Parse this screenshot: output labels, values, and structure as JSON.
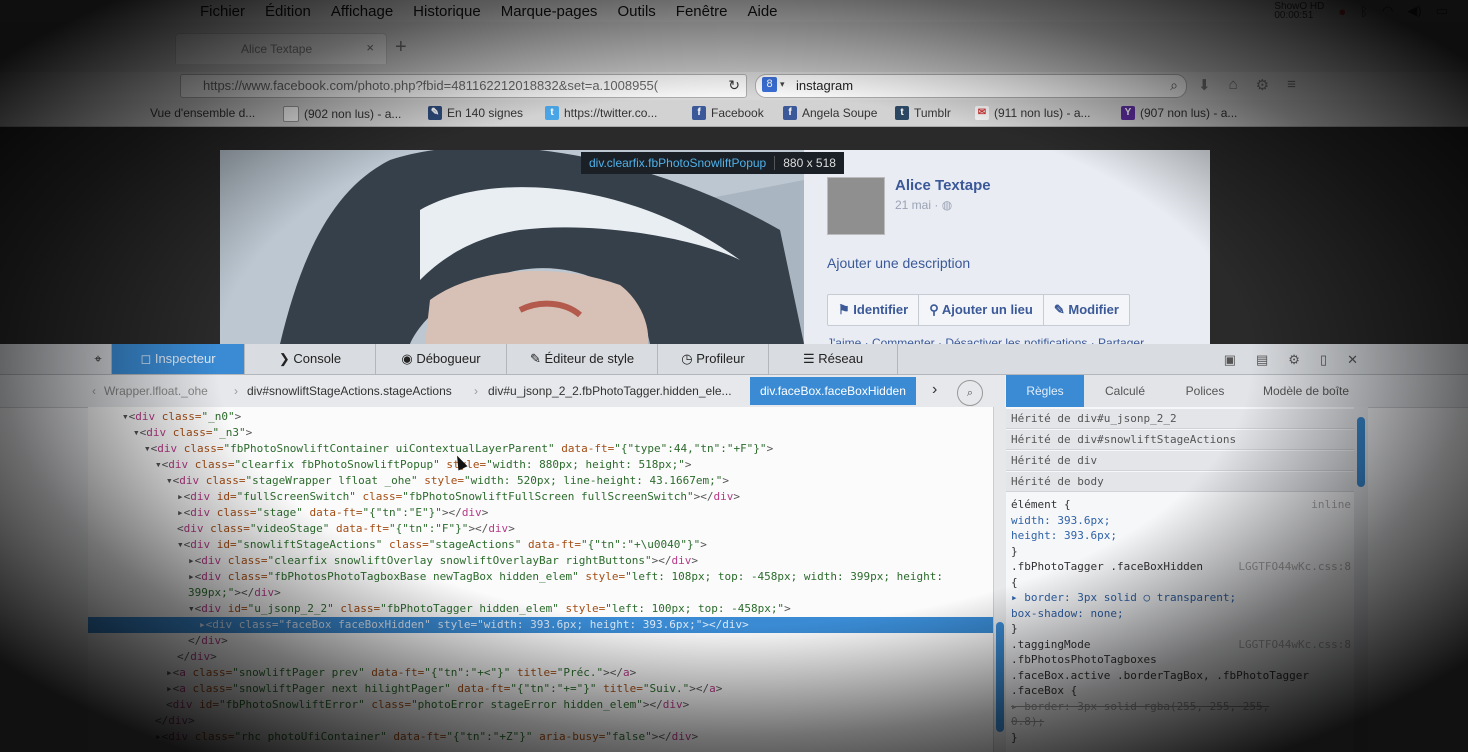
{
  "menubar": {
    "items": [
      "Fichier",
      "Édition",
      "Affichage",
      "Historique",
      "Marque-pages",
      "Outils",
      "Fenêtre",
      "Aide"
    ],
    "clock_top": "ShowO HD",
    "clock_bottom": "00:00:51"
  },
  "browser": {
    "tab_title": "Alice Textape",
    "tab_close": "×",
    "newtab": "+",
    "url": "https://www.facebook.com/photo.php?fbid=481162212018832&set=a.1008955(",
    "search_engine": "8",
    "search_query": "instagram",
    "bookmarks": [
      {
        "label": "Vue d'ensemble d...",
        "icon": "page-icon"
      },
      {
        "label": "(902 non lus) - a...",
        "icon": "page-icon"
      },
      {
        "label": "En 140 signes",
        "icon": "bookmark-icon"
      },
      {
        "label": "https://twitter.co...",
        "icon": "twitter-icon"
      },
      {
        "label": "Facebook",
        "icon": "facebook-icon"
      },
      {
        "label": "Angela Soupe",
        "icon": "facebook-icon"
      },
      {
        "label": "Tumblr",
        "icon": "tumblr-icon"
      },
      {
        "label": "(911 non lus) - a...",
        "icon": "mail-icon"
      },
      {
        "label": "(907 non lus) - a...",
        "icon": "yahoo-icon"
      }
    ]
  },
  "facebook": {
    "user": "Alice Textape",
    "date": "21 mai · ",
    "add_description": "Ajouter une description",
    "actions": [
      "Identifier",
      "Ajouter un lieu",
      "Modifier"
    ],
    "likes_line": "J'aime · Commenter · Désactiver les notifications · Partager"
  },
  "inspector_tooltip": {
    "selector": "div.clearfix.fbPhotoSnowliftPopup",
    "size": "880 x 518"
  },
  "devtools": {
    "tabs": [
      "Inspecteur",
      "Console",
      "Débogueur",
      "Éditeur de style",
      "Profileur",
      "Réseau"
    ],
    "breadcrumbs": [
      "Wrapper.lfloat._ohe",
      "div#snowliftStageActions.stageActions",
      "div#u_jsonp_2_2.fbPhotoTagger.hidden_ele...",
      "div.faceBox.faceBoxHidden"
    ],
    "side_tabs": [
      "Règles",
      "Calculé",
      "Polices",
      "Modèle de boîte"
    ],
    "inherited": [
      "Hérité de div#u_jsonp_2_2",
      "Hérité de div#snowliftStageActions",
      "Hérité de div",
      "Hérité de body"
    ],
    "rules": [
      {
        "text": "élément {",
        "src": "inline"
      },
      {
        "text": "    width: 393.6px;",
        "src": ""
      },
      {
        "text": "    height: 393.6px;",
        "src": ""
      },
      {
        "text": "}",
        "src": ""
      },
      {
        "text": ".fbPhotoTagger .faceBoxHidden",
        "src": "LGGTFO44wKc.css:8"
      },
      {
        "text": "{",
        "src": ""
      },
      {
        "text": "  ▸ border: 3px solid ○ transparent;",
        "src": ""
      },
      {
        "text": "    box-shadow: none;",
        "src": ""
      },
      {
        "text": "}",
        "src": ""
      },
      {
        "text": ".taggingMode",
        "src": "LGGTFO44wKc.css:8"
      },
      {
        "text": ".fbPhotosPhotoTagboxes",
        "src": ""
      },
      {
        "text": ".faceBox.active .borderTagBox, .fbPhotoTagger",
        "src": ""
      },
      {
        "text": ".faceBox {",
        "src": ""
      },
      {
        "text": "  ▸ border: 3px solid  rgba(255, 255, 255,",
        "src": ""
      },
      {
        "text": "0.8);",
        "src": ""
      },
      {
        "text": "}",
        "src": ""
      }
    ],
    "markup": [
      {
        "i": 4,
        "parts": [
          [
            "p",
            "▾<"
          ],
          [
            "t",
            "div"
          ],
          [
            "a",
            " class="
          ],
          [
            "v",
            "\"_n0\""
          ],
          [
            "p",
            ">"
          ]
        ]
      },
      {
        "i": 5,
        "parts": [
          [
            "p",
            "▾<"
          ],
          [
            "t",
            "div"
          ],
          [
            "a",
            " class="
          ],
          [
            "v",
            "\"_n3\""
          ],
          [
            "p",
            ">"
          ]
        ]
      },
      {
        "i": 6,
        "parts": [
          [
            "p",
            "▾<"
          ],
          [
            "t",
            "div"
          ],
          [
            "a",
            " class="
          ],
          [
            "v",
            "\"fbPhotoSnowliftContainer uiContextualLayerParent\""
          ],
          [
            "a",
            " data-ft="
          ],
          [
            "v",
            "\"{\"type\":44,\"tn\":\"+F\"}\""
          ],
          [
            "p",
            ">"
          ]
        ]
      },
      {
        "i": 7,
        "parts": [
          [
            "p",
            "▾<"
          ],
          [
            "t",
            "div"
          ],
          [
            "a",
            " class="
          ],
          [
            "v",
            "\"clearfix fbPhotoSnowliftPopup\""
          ],
          [
            "a",
            " style="
          ],
          [
            "v",
            "\"width: 880px; height: 518px;\""
          ],
          [
            "p",
            ">"
          ]
        ]
      },
      {
        "i": 8,
        "parts": [
          [
            "p",
            "▾<"
          ],
          [
            "t",
            "div"
          ],
          [
            "a",
            " class="
          ],
          [
            "v",
            "\"stageWrapper lfloat _ohe\""
          ],
          [
            "a",
            " style="
          ],
          [
            "v",
            "\"width: 520px; line-height: 43.1667em;\""
          ],
          [
            "p",
            ">"
          ]
        ]
      },
      {
        "i": 9,
        "parts": [
          [
            "p",
            "▸<"
          ],
          [
            "t",
            "div"
          ],
          [
            "a",
            " id="
          ],
          [
            "v",
            "\"fullScreenSwitch\""
          ],
          [
            "a",
            " class="
          ],
          [
            "v",
            "\"fbPhotoSnowliftFullScreen fullScreenSwitch\""
          ],
          [
            "p",
            "></"
          ],
          [
            "t",
            "div"
          ],
          [
            "p",
            ">"
          ]
        ]
      },
      {
        "i": 9,
        "parts": [
          [
            "p",
            "▸<"
          ],
          [
            "t",
            "div"
          ],
          [
            "a",
            " class="
          ],
          [
            "v",
            "\"stage\""
          ],
          [
            "a",
            " data-ft="
          ],
          [
            "v",
            "\"{\"tn\":\"E\"}\""
          ],
          [
            "p",
            "></"
          ],
          [
            "t",
            "div"
          ],
          [
            "p",
            ">"
          ]
        ]
      },
      {
        "i": 9,
        "parts": [
          [
            "p",
            " <"
          ],
          [
            "t",
            "div"
          ],
          [
            "a",
            " class="
          ],
          [
            "v",
            "\"videoStage\""
          ],
          [
            "a",
            " data-ft="
          ],
          [
            "v",
            "\"{\"tn\":\"F\"}\""
          ],
          [
            "p",
            "></"
          ],
          [
            "t",
            "div"
          ],
          [
            "p",
            ">"
          ]
        ]
      },
      {
        "i": 9,
        "parts": [
          [
            "p",
            "▾<"
          ],
          [
            "t",
            "div"
          ],
          [
            "a",
            " id="
          ],
          [
            "v",
            "\"snowliftStageActions\""
          ],
          [
            "a",
            " class="
          ],
          [
            "v",
            "\"stageActions\""
          ],
          [
            "a",
            " data-ft="
          ],
          [
            "v",
            "\"{\"tn\":\"+\\u0040\"}\""
          ],
          [
            "p",
            ">"
          ]
        ]
      },
      {
        "i": 10,
        "parts": [
          [
            "p",
            "▸<"
          ],
          [
            "t",
            "div"
          ],
          [
            "a",
            " class="
          ],
          [
            "v",
            "\"clearfix snowliftOverlay snowliftOverlayBar rightButtons\""
          ],
          [
            "p",
            "></"
          ],
          [
            "t",
            "div"
          ],
          [
            "p",
            ">"
          ]
        ]
      },
      {
        "i": 10,
        "parts": [
          [
            "p",
            "▸<"
          ],
          [
            "t",
            "div"
          ],
          [
            "a",
            " class="
          ],
          [
            "v",
            "\"fbPhotosPhotoTagboxBase newTagBox hidden_elem\""
          ],
          [
            "a",
            " style="
          ],
          [
            "v",
            "\"left: 108px; top: -458px; width: 399px; height:"
          ]
        ]
      },
      {
        "i": 10,
        "parts": [
          [
            "v",
            "399px;\""
          ],
          [
            "p",
            "></"
          ],
          [
            "t",
            "div"
          ],
          [
            "p",
            ">"
          ]
        ]
      },
      {
        "i": 10,
        "parts": [
          [
            "p",
            "▾<"
          ],
          [
            "t",
            "div"
          ],
          [
            "a",
            " id="
          ],
          [
            "v",
            "\"u_jsonp_2_2\""
          ],
          [
            "a",
            " class="
          ],
          [
            "v",
            "\"fbPhotoTagger hidden_elem\""
          ],
          [
            "a",
            " style="
          ],
          [
            "v",
            "\"left: 100px; top: -458px;\""
          ],
          [
            "p",
            ">"
          ]
        ]
      },
      {
        "i": 11,
        "sel": true,
        "parts": [
          [
            "p",
            "▸<"
          ],
          [
            "t",
            "div"
          ],
          [
            "a",
            " class="
          ],
          [
            "v",
            "\"faceBox faceBoxHidden\""
          ],
          [
            "a",
            " style="
          ],
          [
            "v",
            "\"width: 393.6px; height: 393.6px;\""
          ],
          [
            "p",
            "></"
          ],
          [
            "t",
            "div"
          ],
          [
            "p",
            ">"
          ]
        ]
      },
      {
        "i": 10,
        "parts": [
          [
            "p",
            "</"
          ],
          [
            "t",
            "div"
          ],
          [
            "p",
            ">"
          ]
        ]
      },
      {
        "i": 9,
        "parts": [
          [
            "p",
            "</"
          ],
          [
            "t",
            "div"
          ],
          [
            "p",
            ">"
          ]
        ]
      },
      {
        "i": 8,
        "parts": [
          [
            "p",
            "▸<"
          ],
          [
            "t",
            "a"
          ],
          [
            "a",
            " class="
          ],
          [
            "v",
            "\"snowliftPager prev\""
          ],
          [
            "a",
            " data-ft="
          ],
          [
            "v",
            "\"{\"tn\":\"+<\"}\""
          ],
          [
            "a",
            " title="
          ],
          [
            "v",
            "\"Préc.\""
          ],
          [
            "p",
            "></"
          ],
          [
            "t",
            "a"
          ],
          [
            "p",
            ">"
          ]
        ]
      },
      {
        "i": 8,
        "parts": [
          [
            "p",
            "▸<"
          ],
          [
            "t",
            "a"
          ],
          [
            "a",
            " class="
          ],
          [
            "v",
            "\"snowliftPager next hilightPager\""
          ],
          [
            "a",
            " data-ft="
          ],
          [
            "v",
            "\"{\"tn\":\"+=\"}\""
          ],
          [
            "a",
            " title="
          ],
          [
            "v",
            "\"Suiv.\""
          ],
          [
            "p",
            "></"
          ],
          [
            "t",
            "a"
          ],
          [
            "p",
            ">"
          ]
        ]
      },
      {
        "i": 8,
        "parts": [
          [
            "p",
            " <"
          ],
          [
            "t",
            "div"
          ],
          [
            "a",
            " id="
          ],
          [
            "v",
            "\"fbPhotoSnowliftError\""
          ],
          [
            "a",
            " class="
          ],
          [
            "v",
            "\"photoError stageError hidden_elem\""
          ],
          [
            "p",
            "></"
          ],
          [
            "t",
            "div"
          ],
          [
            "p",
            ">"
          ]
        ]
      },
      {
        "i": 7,
        "parts": [
          [
            "p",
            "</"
          ],
          [
            "t",
            "div"
          ],
          [
            "p",
            ">"
          ]
        ]
      },
      {
        "i": 7,
        "parts": [
          [
            "p",
            "▸<"
          ],
          [
            "t",
            "div"
          ],
          [
            "a",
            " class="
          ],
          [
            "v",
            "\"rhc photoUfiContainer\""
          ],
          [
            "a",
            " data-ft="
          ],
          [
            "v",
            "\"{\"tn\":\"+Z\"}\""
          ],
          [
            "a",
            " aria-busy="
          ],
          [
            "v",
            "\"false\""
          ],
          [
            "p",
            "></"
          ],
          [
            "t",
            "div"
          ],
          [
            "p",
            ">"
          ]
        ]
      }
    ]
  },
  "colors": {
    "devtools_accent": "#3a8bd4",
    "facebook_blue": "#3b5998"
  }
}
